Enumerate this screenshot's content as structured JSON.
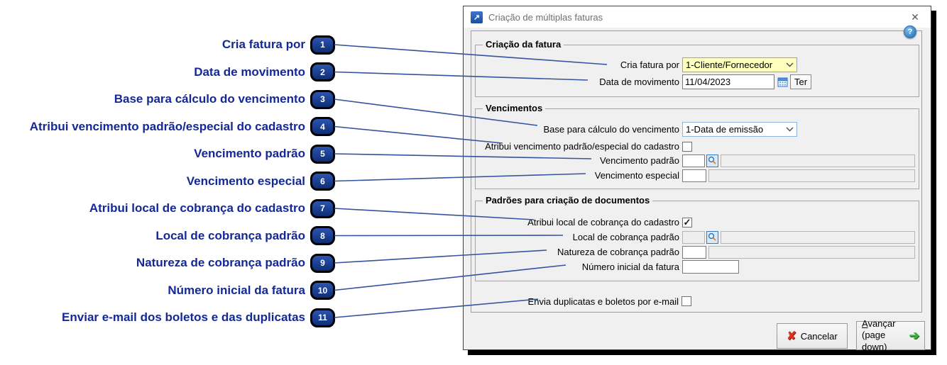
{
  "annotations": {
    "items": [
      {
        "num": "1",
        "label": "Cria fatura por"
      },
      {
        "num": "2",
        "label": "Data de movimento"
      },
      {
        "num": "3",
        "label": "Base para cálculo do vencimento"
      },
      {
        "num": "4",
        "label": "Atribui vencimento padrão/especial do cadastro"
      },
      {
        "num": "5",
        "label": "Vencimento padrão"
      },
      {
        "num": "6",
        "label": "Vencimento especial"
      },
      {
        "num": "7",
        "label": "Atribui local de cobrança do cadastro"
      },
      {
        "num": "8",
        "label": "Local de cobrança padrão"
      },
      {
        "num": "9",
        "label": "Natureza de cobrança padrão"
      },
      {
        "num": "10",
        "label": "Número inicial da fatura"
      },
      {
        "num": "11",
        "label": "Enviar e-mail dos boletos e das duplicatas"
      }
    ],
    "label_color": "#142896",
    "line_color": "#35539f"
  },
  "dialog": {
    "title": "Criação de múltiplas faturas",
    "icons": {
      "app": "↗",
      "close": "✕",
      "help": "?",
      "cancel_x": "✘",
      "next_arrow": "➔"
    },
    "criacao": {
      "title": "Criação da fatura",
      "cria_fatura_label": "Cria fatura por",
      "cria_fatura_value": "1-Cliente/Fornecedor",
      "data_mov_label": "Data de movimento",
      "data_mov_value": "11/04/2023",
      "data_mov_day": "Ter"
    },
    "vencimentos": {
      "title": "Vencimentos",
      "base_label": "Base para cálculo do vencimento",
      "base_value": "1-Data de emissão",
      "atribui_label": "Atribui vencimento padrão/especial do cadastro",
      "atribui_checked": false,
      "venc_padrao_label": "Vencimento padrão",
      "venc_padrao_code": "",
      "venc_padrao_desc": "",
      "venc_especial_label": "Vencimento especial",
      "venc_especial_code": "",
      "venc_especial_desc": ""
    },
    "padroes": {
      "title": "Padrões para criação de documentos",
      "atribui_local_label": "Atribui local de cobrança do cadastro",
      "atribui_local_checked": true,
      "local_label": "Local de cobrança padrão",
      "local_code": "",
      "local_desc": "",
      "natureza_label": "Natureza de cobrança padrão",
      "natureza_code": "",
      "natureza_desc": "",
      "numero_label": "Número inicial da fatura",
      "numero_value": ""
    },
    "envia_label": "Envia duplicatas e boletos por e-mail",
    "envia_checked": false,
    "buttons": {
      "cancel": "Cancelar",
      "next_line1": "Avançar",
      "next_line2": "(page down)"
    }
  }
}
